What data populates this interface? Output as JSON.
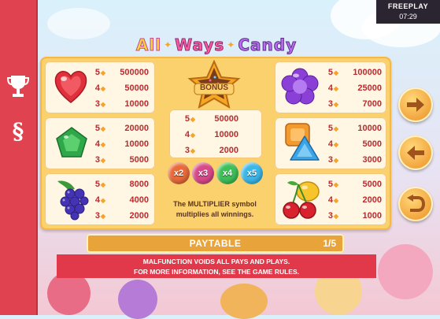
{
  "status": {
    "mode": "FREEPLAY",
    "time": "07:29"
  },
  "sidebar": [
    {
      "icon": "trophy-icon"
    },
    {
      "icon": "section-sign-icon",
      "glyph": "§"
    }
  ],
  "title": {
    "word1": "All",
    "word2": "Ways",
    "word3": "Candy"
  },
  "paytable": {
    "symbols": [
      {
        "name": "heart",
        "pays": [
          {
            "count": "5",
            "value": "500000"
          },
          {
            "count": "4",
            "value": "50000"
          },
          {
            "count": "3",
            "value": "10000"
          }
        ]
      },
      {
        "name": "pentagon",
        "pays": [
          {
            "count": "5",
            "value": "20000"
          },
          {
            "count": "4",
            "value": "10000"
          },
          {
            "count": "3",
            "value": "5000"
          }
        ]
      },
      {
        "name": "grapes",
        "pays": [
          {
            "count": "5",
            "value": "8000"
          },
          {
            "count": "4",
            "value": "4000"
          },
          {
            "count": "3",
            "value": "2000"
          }
        ]
      },
      {
        "name": "flower",
        "pays": [
          {
            "count": "5",
            "value": "100000"
          },
          {
            "count": "4",
            "value": "25000"
          },
          {
            "count": "3",
            "value": "7000"
          }
        ]
      },
      {
        "name": "square-triangle",
        "pays": [
          {
            "count": "5",
            "value": "10000"
          },
          {
            "count": "4",
            "value": "5000"
          },
          {
            "count": "3",
            "value": "3000"
          }
        ]
      },
      {
        "name": "cherries",
        "pays": [
          {
            "count": "5",
            "value": "5000"
          },
          {
            "count": "4",
            "value": "2000"
          },
          {
            "count": "3",
            "value": "1000"
          }
        ]
      }
    ],
    "bonus": {
      "label": "BONUS",
      "pays": [
        {
          "count": "5",
          "value": "50000"
        },
        {
          "count": "4",
          "value": "10000"
        },
        {
          "count": "3",
          "value": "2000"
        }
      ]
    },
    "multipliers": [
      "x2",
      "x3",
      "x4",
      "x5"
    ],
    "multiplier_text_line1": "The MULTIPLIER symbol",
    "multiplier_text_line2": "multiplies all winnings."
  },
  "nav": {
    "next": "arrow-right-icon",
    "prev": "arrow-left-icon",
    "back": "return-icon"
  },
  "bar": {
    "label": "PAYTABLE",
    "page": "1/5"
  },
  "footer": {
    "line1": "MALFUNCTION VOIDS ALL PAYS AND PLAYS.",
    "line2": "FOR MORE INFORMATION, SEE THE GAME RULES."
  },
  "colors": {
    "sidebar": "#e0434f",
    "panel": "#fbd16e",
    "pay_value": "#c0282e",
    "footer": "#e2394a"
  }
}
